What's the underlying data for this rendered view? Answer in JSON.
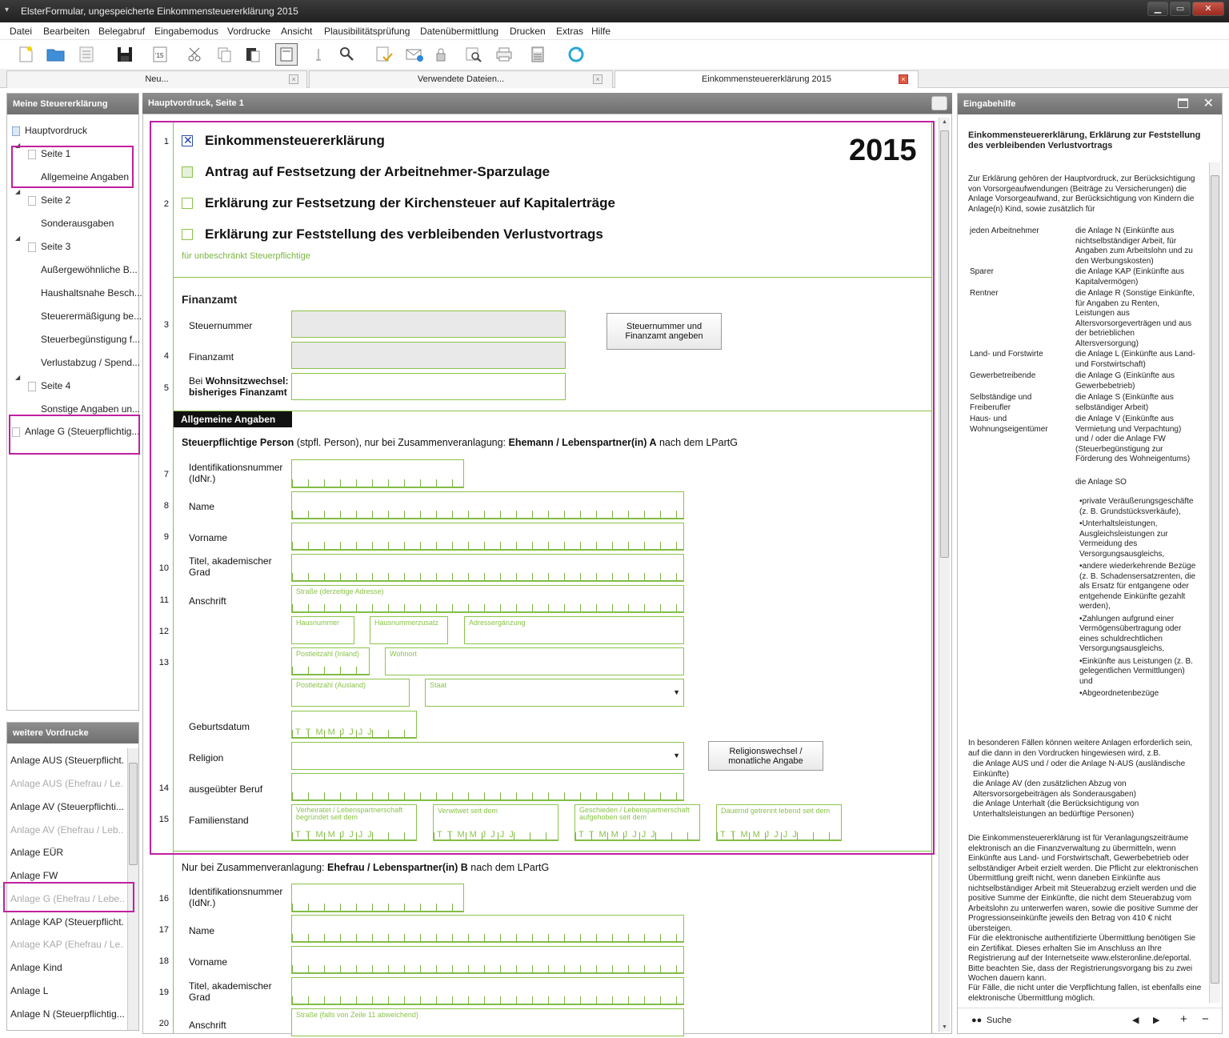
{
  "window": {
    "title": "ElsterFormular, ungespeicherte Einkommensteuererklärung 2015"
  },
  "menu": [
    "Datei",
    "Bearbeiten",
    "Belegabruf",
    "Eingabemodus",
    "Vordrucke",
    "Ansicht",
    "Plausibilitätsprüfung",
    "Datenübermittlung",
    "Drucken",
    "Extras",
    "Hilfe"
  ],
  "tabs": [
    {
      "label": "Neu..."
    },
    {
      "label": "Verwendete Dateien..."
    },
    {
      "label": "Einkommensteuererklärung 2015"
    }
  ],
  "left": {
    "title": "Meine Steuererklärung",
    "tree": [
      "Hauptvordruck",
      "Seite 1",
      "Allgemeine Angaben",
      "Seite 2",
      "Sonderausgaben",
      "Seite 3",
      "Außergewöhnliche B...",
      "Haushaltsnahe Besch...",
      "Steuerermäßigung be...",
      "Steuerbegünstigung f...",
      "Verlustabzug / Spend...",
      "Seite 4",
      "Sonstige Angaben un...",
      "Anlage G (Steuerpflichtig..."
    ],
    "weitere_title": "weitere Vordrucke",
    "weitere": [
      "Anlage AUS (Steuerpflicht...",
      "Anlage AUS (Ehefrau / Le...",
      "Anlage AV (Steuerpflichti...",
      "Anlage AV (Ehefrau / Leb...",
      "Anlage EÜR",
      "Anlage FW",
      "Anlage G (Ehefrau / Lebe...",
      "Anlage KAP (Steuerpflicht...",
      "Anlage KAP (Ehefrau / Le...",
      "Anlage Kind",
      "Anlage L",
      "Anlage N (Steuerpflichtig..."
    ]
  },
  "main": {
    "title": "Hauptvordruck, Seite 1",
    "year": "2015",
    "checks": [
      "Einkommensteuererklärung",
      "Antrag auf Festsetzung der Arbeitnehmer-Sparzulage",
      "Erklärung zur Festsetzung der Kirchensteuer auf Kapitalerträge",
      "Erklärung zur Feststellung des verbleibenden Verlustvortrags"
    ],
    "unbeschraenkt": "für unbeschränkt Steuerpflichtige",
    "finanzamt_title": "Finanzamt",
    "steuernummer": "Steuernummer",
    "finanzamt": "Finanzamt",
    "wohnsitz_a": "Bei ",
    "wohnsitz_b": "Wohnsitzwechsel:",
    "wohnsitz_c": "bisheriges Finanzamt",
    "stnr_button": "Steuernummer und Finanzamt angeben",
    "section": "Allgemeine Angaben",
    "person_a": "Steuerpflichtige Person",
    "person_b": " (stpfl. Person), nur bei Zusammenveranlagung: ",
    "person_c": "Ehemann / Lebenspartner(in) A",
    "person_d": " nach dem LPartG",
    "idnr": "Identifikationsnummer (IdNr.)",
    "name": "Name",
    "vorname": "Vorname",
    "titel": "Titel, akademischer Grad",
    "anschrift": "Anschrift",
    "strasse_hint": "Straße (derzeitige Adresse)",
    "hausnummer_hint": "Hausnummer",
    "hnzusatz_hint": "Hausnummerzusatz",
    "adresserg_hint": "Adressergänzung",
    "plz_inland_hint": "Postleitzahl (Inland)",
    "wohnort_hint": "Wohnort",
    "plz_ausland_hint": "Postleitzahl (Ausland)",
    "staat_hint": "Staat",
    "geburtsdatum": "Geburtsdatum",
    "date_chars": "TTMMJJJJ",
    "religion": "Religion",
    "religion_button": "Religionswechsel / monatliche Angabe",
    "beruf": "ausgeübter Beruf",
    "familienstand": "Familienstand",
    "fs_hints": [
      "Verheiratet / Lebenspartnerschaft begründet seit dem",
      "Verwitwet seit dem",
      "Geschieden / Lebenspartnerschaft aufgehoben seit dem",
      "Dauernd getrennt lebend seit dem"
    ],
    "ehefrau_a": "Nur bei Zusammenveranlagung: ",
    "ehefrau_b": "Ehefrau / Lebenspartner(in) B",
    "ehefrau_c": " nach dem LPartG",
    "strasse_b_hint": "Straße (falls von Zeile 11 abweichend)",
    "linenums": [
      "1",
      "2",
      "3",
      "4",
      "5",
      "7",
      "8",
      "9",
      "10",
      "11",
      "12",
      "13",
      "14",
      "15",
      "16",
      "17",
      "18",
      "19",
      "20"
    ]
  },
  "right": {
    "title": "Eingabehilfe",
    "heading": "Einkommensteuererklärung, Erklärung zur Feststellung des verbleibenden Verlustvortrags",
    "intro": "Zur Erklärung gehören der Hauptvordruck, zur Berücksichtigung von Vorsorgeaufwendungen (Beiträge zu Versicherungen) die Anlage Vorsorgeaufwand, zur Berücksichtigung von Kindern die Anlage(n) Kind, sowie zusätzlich für",
    "rows": [
      {
        "k": "jeden Arbeitnehmer",
        "v": "die Anlage N (Einkünfte aus nichtselbständiger Arbeit, für Angaben zum Arbeitslohn und zu den Werbungskosten)"
      },
      {
        "k": "Sparer",
        "v": "die Anlage KAP (Einkünfte aus Kapitalvermögen)"
      },
      {
        "k": "Rentner",
        "v": "die Anlage R (Sonstige Einkünfte, für Angaben zu Renten, Leistungen aus Altersvorsorgeverträgen und aus der betrieblichen Altersversorgung)"
      },
      {
        "k": "Land- und Forstwirte",
        "v": "die Anlage L (Einkünfte aus Land- und Forstwirtschaft)"
      },
      {
        "k": "Gewerbetreibende",
        "v": "die Anlage G (Einkünfte aus Gewerbebetrieb)"
      },
      {
        "k": "Selbständige und Freiberufler",
        "v": "die Anlage S (Einkünfte aus selbständiger Arbeit)"
      },
      {
        "k": "Haus- und Wohnungseigentümer",
        "v": "die Anlage V (Einkünfte aus Vermietung und Verpachtung) und / oder die Anlage FW (Steuerbegünstigung zur Förderung des Wohneigentums)"
      }
    ],
    "so": "die Anlage SO",
    "bullets": [
      "private Veräußerungsgeschäfte (z. B. Grundstücksverkäufe),",
      "Unterhaltsleistungen, Ausgleichsleistungen zur Vermeidung des Versorgungsausgleichs,",
      "andere wiederkehrende Bezüge (z. B. Schadensersatzrenten, die als Ersatz für entgangene oder entgehende Einkünfte gezahlt werden),",
      "Zahlungen aufgrund einer Vermögensübertragung oder eines schuldrechtlichen Versorgungsausgleichs,",
      "Einkünfte aus Leistungen (z. B. gelegentlichen Vermittlungen) und",
      "Abgeordnetenbezüge"
    ],
    "special": "In besonderen Fällen können weitere Anlagen erforderlich sein, auf die dann in den Vordrucken hingewiesen wird, z.B.",
    "special_items": [
      "die Anlage AUS und / oder die Anlage N-AUS (ausländische Einkünfte)",
      "die Anlage AV (den zusätzlichen Abzug von Altersvorsorgebeiträgen als Sonderausgaben)",
      "die Anlage Unterhalt (die Berücksichtigung von Unterhaltsleistungen an bedürftige Personen)"
    ],
    "para": "Die Einkommensteuererklärung ist für Veranlagungszeiträume elektronisch an die Finanzverwaltung zu übermitteln, wenn Einkünfte aus Land- und Forstwirtschaft, Gewerbebetrieb oder selbständiger Arbeit erzielt werden. Die Pflicht zur elektronischen Übermittlung greift nicht, wenn daneben Einkünfte aus nichtselbständiger Arbeit mit Steuerabzug erzielt werden und die positive Summe der Einkünfte, die nicht dem Steuerabzug vom Arbeitslohn zu unterwerfen waren, sowie die positive Summe der Progressionseinkünfte jeweils den Betrag von 410 € nicht übersteigen.",
    "para2": "Für die elektronische authentifizierte Übermittlung benötigen Sie ein Zertifikat. Dieses erhalten Sie im Anschluss an Ihre Registrierung auf der Internetseite www.elsteronline.de/eportal. Bitte beachten Sie, dass der Registrierungsvorgang bis zu zwei Wochen dauern kann.",
    "para3": "Für Fälle, die nicht unter die Verpflichtung fallen, ist ebenfalls eine elektronische Übermittlung möglich.",
    "search": "Suche"
  }
}
